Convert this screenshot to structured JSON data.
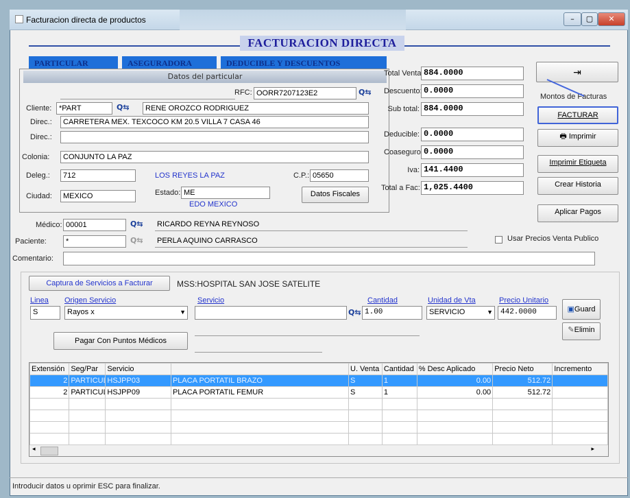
{
  "window": {
    "title": "Facturacion directa de productos",
    "min": "–",
    "max": "▢",
    "close": "✕"
  },
  "header": {
    "title": "FACTURACION DIRECTA"
  },
  "tabs": [
    "PARTICULAR",
    "ASEGURADORA",
    "DEDUCIBLE Y DESCUENTOS"
  ],
  "particular": {
    "panel_title": "Datos del particular",
    "rfc_label": "RFC:",
    "rfc": "OORR7207123E2",
    "cliente_label": "Cliente:",
    "cliente_code": "*PART",
    "cliente_name": "RENE  OROZCO RODRIGUEZ",
    "direc_label": "Direc.:",
    "direc1": "CARRETERA MEX. TEXCOCO KM 20.5 VILLA 7 CASA 46",
    "direc2": "",
    "colonia_label": "Colonia:",
    "colonia": "CONJUNTO LA PAZ",
    "deleg_label": "Deleg.:",
    "deleg": "712",
    "deleg_name": "LOS REYES LA PAZ",
    "cp_label": "C.P.:",
    "cp": "05650",
    "ciudad_label": "Ciudad:",
    "ciudad": "MEXICO",
    "estado_label": "Estado:",
    "estado": "ME",
    "estado_name": "EDO MEXICO",
    "datos_fiscales": "Datos Fiscales"
  },
  "totals": {
    "total_venta_label": "Total Venta:",
    "total_venta": "884.0000",
    "descuento_label": "Descuento:",
    "descuento": "0.0000",
    "subtotal_label": "Sub total:",
    "subtotal": "884.0000",
    "deducible_label": "Deducible:",
    "deducible": "0.0000",
    "coaseguro_label": "Coaseguro:",
    "coaseguro": "0.0000",
    "iva_label": "Iva:",
    "iva": "141.4400",
    "total_fac_label": "Total a Fac:",
    "total_fac": "1,025.4400"
  },
  "side_buttons": {
    "montos": "Montos de Facturas",
    "facturar": "FACTURAR",
    "imprimir": "Imprimir",
    "etiqueta": "Imprimir Etiqueta",
    "historia": "Crear Historia",
    "pagos": "Aplicar Pagos"
  },
  "medico": {
    "label": "Médico:",
    "code": "00001",
    "name": "RICARDO REYNA REYNOSO"
  },
  "paciente": {
    "label": "Paciente:",
    "code": "*",
    "name": "PERLA AQUINO CARRASCO"
  },
  "comentario_label": "Comentario:",
  "usar_precios": "Usar Precios Venta Publico",
  "captura": {
    "button": "Captura de Servicios a Facturar",
    "mss": "MSS:HOSPITAL SAN JOSE SATELITE",
    "linea_label": "Linea",
    "linea": "S",
    "origen_label": "Origen Servicio",
    "origen": "Rayos x",
    "servicio_label": "Servicio",
    "servicio": "",
    "cantidad_label": "Cantidad",
    "cantidad": "1.00",
    "unidad_label": "Unidad de Vta",
    "unidad": "SERVICIO",
    "precio_label": "Precio Unitario",
    "precio": "442.0000",
    "guardar": "Guard",
    "eliminar": "Elimin",
    "pagar_puntos": "Pagar Con Puntos Médicos"
  },
  "table": {
    "headers": [
      "Extensión",
      "Seg/Par",
      "Servicio",
      "",
      "U. Venta",
      "Cantidad",
      "% Desc Aplicado",
      "Precio Neto",
      "Incremento"
    ],
    "rows": [
      [
        "2",
        "PARTICUL",
        "HSJPP03",
        "PLACA PORTATIL BRAZO",
        "S",
        "1",
        "0.00",
        "512.72",
        ""
      ],
      [
        "2",
        "PARTICUL",
        "HSJPP09",
        "PLACA PORTATIL FEMUR",
        "S",
        "1",
        "0.00",
        "512.72",
        ""
      ]
    ]
  },
  "status": "Introducir datos u oprimir ESC para finalizar."
}
